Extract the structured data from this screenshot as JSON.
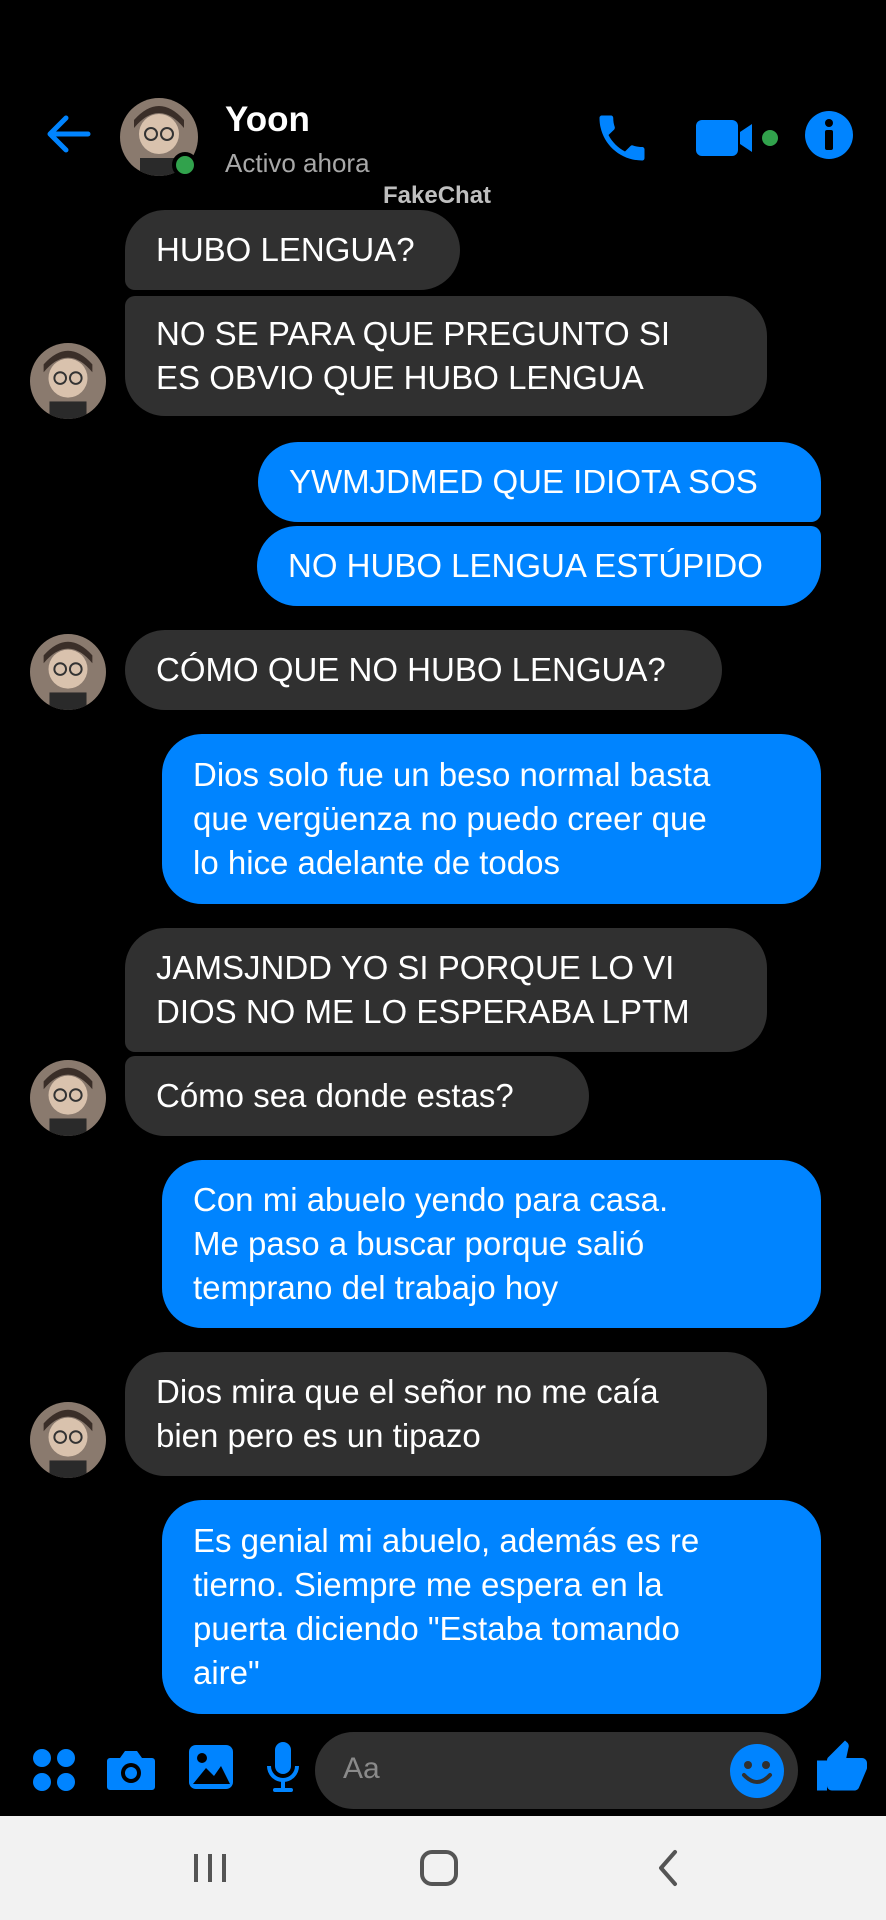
{
  "header": {
    "contact_name": "Yoon",
    "status": "Activo ahora",
    "watermark": "FakeChat"
  },
  "messages": [
    {
      "side": "in",
      "text": "HUBO LENGUA?"
    },
    {
      "side": "in",
      "text": "NO SE PARA QUE PREGUNTO SI\nES OBVIO QUE HUBO LENGUA"
    },
    {
      "side": "out",
      "text": "YWMJDMED QUE IDIOTA SOS"
    },
    {
      "side": "out",
      "text": "NO HUBO LENGUA ESTÚPIDO"
    },
    {
      "side": "in",
      "text": "CÓMO QUE NO HUBO LENGUA?"
    },
    {
      "side": "out",
      "text": "Dios solo fue un beso normal basta\nque vergüenza no puedo creer que\nlo hice adelante de todos"
    },
    {
      "side": "in",
      "text": "JAMSJNDD YO SI PORQUE LO VI\nDIOS NO ME LO ESPERABA LPTM"
    },
    {
      "side": "in",
      "text": "Cómo sea donde estas?"
    },
    {
      "side": "out",
      "text": "Con mi abuelo yendo para casa.\nMe paso a buscar porque salió\ntemprano del trabajo hoy"
    },
    {
      "side": "in",
      "text": "Dios mira que el señor no me caía\nbien pero es un tipazo"
    },
    {
      "side": "out",
      "text": "Es genial mi abuelo, además es re\ntierno. Siempre me espera en la\npuerta diciendo \"Estaba tomando\naire\""
    }
  ],
  "composer": {
    "placeholder": "Aa"
  },
  "colors": {
    "accent": "#0084ff",
    "incoming_bubble": "#303030",
    "online": "#31a24c"
  }
}
